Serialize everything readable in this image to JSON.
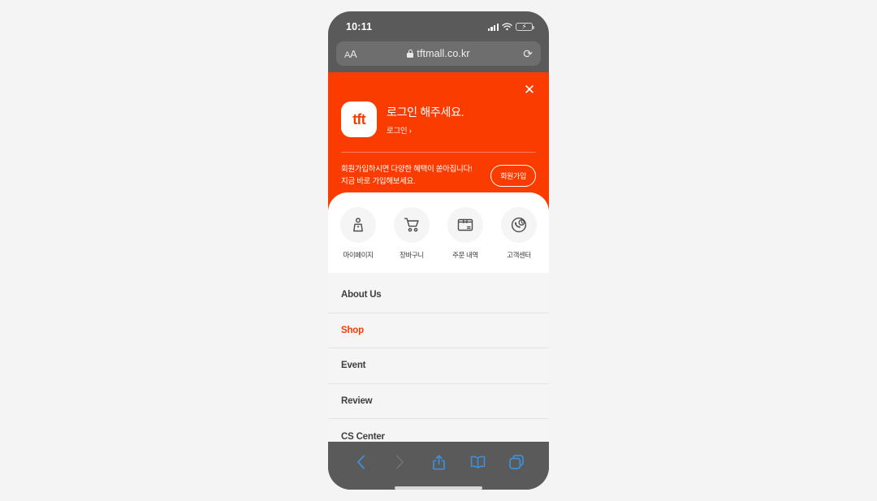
{
  "theme": {
    "orange": "#fa3c00",
    "safari_chrome": "#5a5a5a",
    "toolbar_blue": "#3e8fd8",
    "page_bg": "#f5f5f5"
  },
  "status_bar": {
    "time": "10:11",
    "cellular_icon": "signal-bars-icon",
    "wifi_icon": "wifi-icon",
    "battery_icon": "battery-charging-icon"
  },
  "browser": {
    "text_size_label": "AA",
    "lock_icon": "lock-icon",
    "url": "tftmall.co.kr",
    "reload_icon": "reload-icon",
    "toolbar": {
      "back": "back-icon",
      "forward": "forward-icon",
      "share": "share-icon",
      "bookmarks": "bookmarks-icon",
      "tabs": "tabs-icon"
    }
  },
  "hero": {
    "close_icon": "close-icon",
    "logo_text": "tft",
    "login_title": "로그인 해주세요.",
    "login_link": "로그인 ›",
    "promo_line1": "회원가입하시면 다양한 혜택이 쏟아집니다!",
    "promo_line2": "지금 바로 가입해보세요.",
    "promo_button": "회원가입"
  },
  "quick_links": [
    {
      "label": "마이페이지",
      "icon": "person-icon"
    },
    {
      "label": "장바구니",
      "icon": "cart-icon"
    },
    {
      "label": "주문 내역",
      "icon": "package-icon"
    },
    {
      "label": "고객센터",
      "icon": "support-clock-icon"
    }
  ],
  "menu": [
    {
      "label": "About Us",
      "active": false
    },
    {
      "label": "Shop",
      "active": true
    },
    {
      "label": "Event",
      "active": false
    },
    {
      "label": "Review",
      "active": false
    },
    {
      "label": "CS Center",
      "active": false
    }
  ]
}
